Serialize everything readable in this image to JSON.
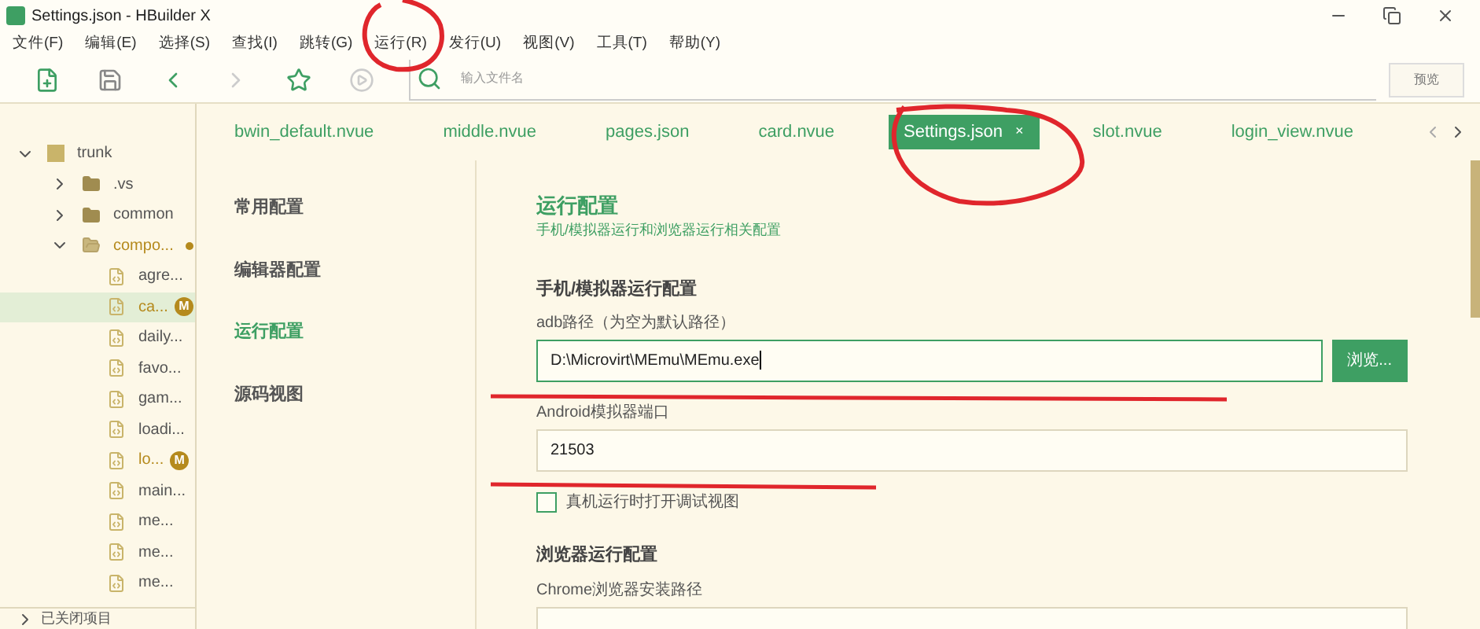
{
  "window": {
    "title": "Settings.json - HBuilder X"
  },
  "menu": [
    "文件(F)",
    "编辑(E)",
    "选择(S)",
    "查找(I)",
    "跳转(G)",
    "运行(R)",
    "发行(U)",
    "视图(V)",
    "工具(T)",
    "帮助(Y)"
  ],
  "toolbar": {
    "search": {
      "placeholder": "输入文件名"
    },
    "preview_button": "预览"
  },
  "tree": [
    {
      "label": "trunk",
      "kind": "project",
      "expanded": true,
      "modified": false,
      "selected": false,
      "children": [
        {
          "label": ".vs",
          "kind": "folder",
          "expanded": false,
          "modified": false,
          "selected": false
        },
        {
          "label": "common",
          "kind": "folder",
          "expanded": false,
          "modified": false,
          "selected": false
        },
        {
          "label": "compo...",
          "kind": "folder",
          "expanded": true,
          "modified": true,
          "selected": false,
          "children": [
            {
              "label": "agre...",
              "kind": "file",
              "modified": false,
              "selected": false
            },
            {
              "label": "ca...",
              "kind": "file",
              "modified": true,
              "selected": true,
              "badge": "M"
            },
            {
              "label": "daily...",
              "kind": "file",
              "modified": false,
              "selected": false
            },
            {
              "label": "favo...",
              "kind": "file",
              "modified": false,
              "selected": false
            },
            {
              "label": "gam...",
              "kind": "file",
              "modified": false,
              "selected": false
            },
            {
              "label": "loadi...",
              "kind": "file",
              "modified": false,
              "selected": false
            },
            {
              "label": "lo...",
              "kind": "file",
              "modified": true,
              "selected": false,
              "badge": "M"
            },
            {
              "label": "main...",
              "kind": "file",
              "modified": false,
              "selected": false
            },
            {
              "label": "me...",
              "kind": "file",
              "modified": false,
              "selected": false
            },
            {
              "label": "me...",
              "kind": "file",
              "modified": false,
              "selected": false
            },
            {
              "label": "me...",
              "kind": "file",
              "modified": false,
              "selected": false
            }
          ]
        }
      ]
    }
  ],
  "closed_projects": "已关闭项目",
  "tabs": [
    {
      "label": "bwin_default.nvue",
      "selected": false
    },
    {
      "label": "middle.nvue",
      "selected": false
    },
    {
      "label": "pages.json",
      "selected": false
    },
    {
      "label": "card.nvue",
      "selected": false
    },
    {
      "label": "Settings.json",
      "selected": true,
      "close": "×"
    },
    {
      "label": "slot.nvue",
      "selected": false
    },
    {
      "label": "login_view.nvue",
      "selected": false
    }
  ],
  "settings_nav": [
    {
      "label": "常用配置",
      "selected": false
    },
    {
      "label": "编辑器配置",
      "selected": false
    },
    {
      "label": "运行配置",
      "selected": true
    },
    {
      "label": "源码视图",
      "selected": false
    }
  ],
  "content": {
    "title": "运行配置",
    "subtitle": "手机/模拟器运行和浏览器运行相关配置",
    "sections": [
      {
        "title": "手机/模拟器运行配置",
        "fields": [
          {
            "kind": "path",
            "label": "adb路径（为空为默认路径）",
            "value": "D:\\Microvirt\\MEmu\\MEmu.exe",
            "focused": true,
            "button": "浏览..."
          },
          {
            "kind": "text",
            "label": "Android模拟器端口",
            "value": "21503",
            "focused": false
          },
          {
            "kind": "checkbox",
            "label": "真机运行时打开调试视图",
            "checked": false
          }
        ]
      },
      {
        "title": "浏览器运行配置",
        "fields": [
          {
            "kind": "path",
            "label": "Chrome浏览器安装路径",
            "focused": false
          }
        ]
      }
    ]
  }
}
